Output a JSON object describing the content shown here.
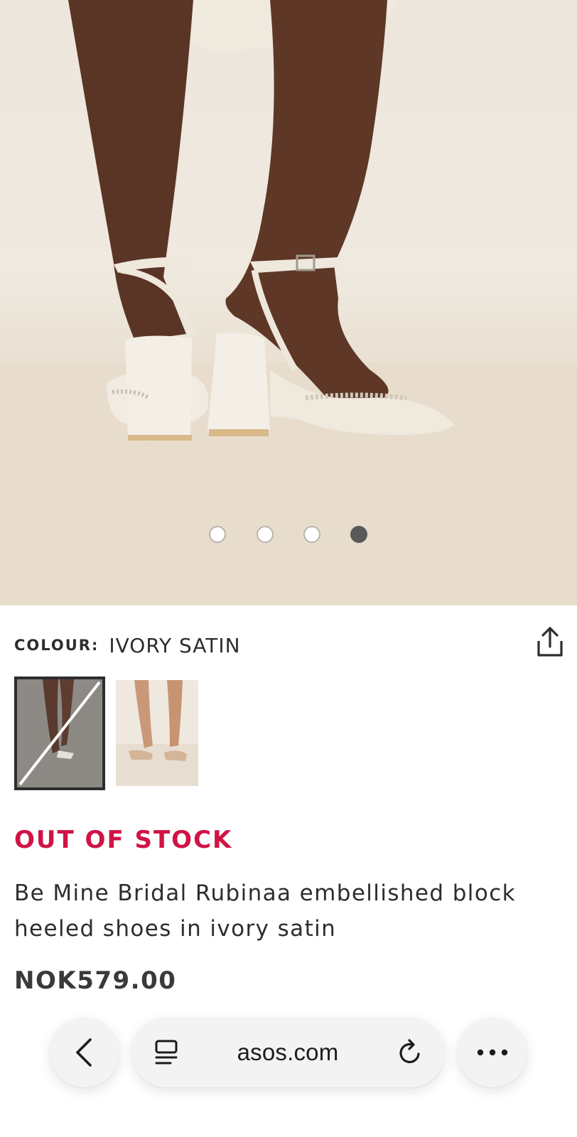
{
  "product": {
    "colour_label": "COLOUR:",
    "colour_value": "IVORY SATIN",
    "stock_status": "OUT OF STOCK",
    "title": "Be Mine Bridal Rubinaa embellished block heeled shoes in ivory satin",
    "price": "NOK579.00"
  },
  "gallery": {
    "image_count": 4,
    "active_index": 3
  },
  "swatches": [
    {
      "colour": "IVORY SATIN",
      "selected": true,
      "unavailable": true
    },
    {
      "colour": "nude",
      "selected": false,
      "unavailable": false
    }
  ],
  "browser": {
    "url": "asos.com",
    "icons": {
      "back": "chevron-left-icon",
      "tabs": "tab-manager-icon",
      "reload": "reload-icon",
      "more": "more-dots-icon",
      "share": "share-icon"
    }
  },
  "colors": {
    "out_of_stock": "#d01345",
    "text": "#2d2d2d",
    "active_dot": "#595959"
  }
}
